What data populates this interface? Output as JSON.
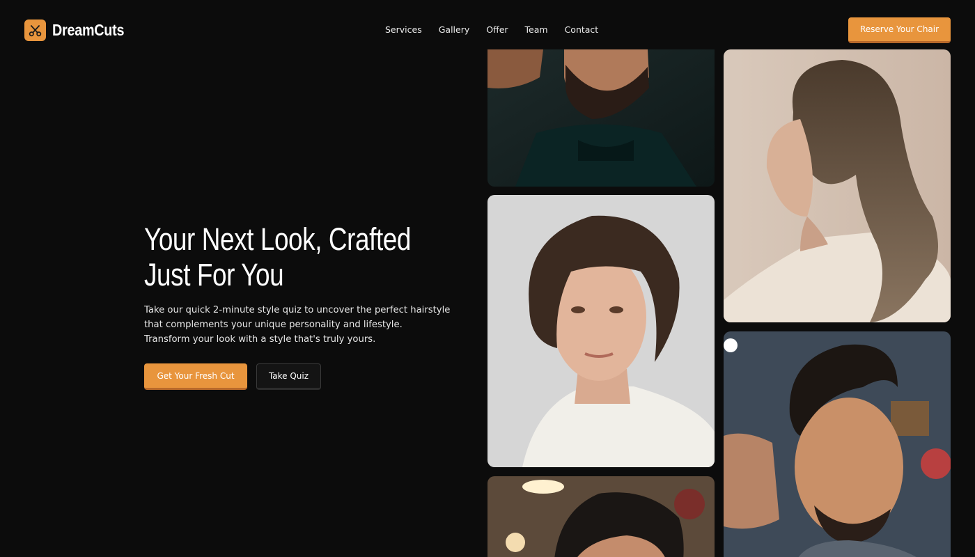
{
  "brand": {
    "name": "DreamCuts",
    "accent": "#e8953d",
    "logo_icon": "scissors-icon"
  },
  "nav": {
    "items": [
      {
        "label": "Services"
      },
      {
        "label": "Gallery"
      },
      {
        "label": "Offer"
      },
      {
        "label": "Team"
      },
      {
        "label": "Contact"
      }
    ]
  },
  "header": {
    "cta_label": "Reserve Your Chair"
  },
  "hero": {
    "title": "Your Next Look, Crafted Just For You",
    "description": "Take our quick 2-minute style quiz to uncover the perfect hairstyle that complements your unique personality and lifestyle. Transform your look with a style that's truly yours.",
    "primary_button": "Get Your Fresh Cut",
    "secondary_button": "Take Quiz"
  },
  "gallery": {
    "images": [
      {
        "alt": "bearded man in black turtleneck"
      },
      {
        "alt": "young man with wavy brown hair"
      },
      {
        "alt": "man with pompadour haircut"
      },
      {
        "alt": "woman with long sleek ponytail"
      },
      {
        "alt": "man with fade haircut at barber"
      }
    ]
  }
}
